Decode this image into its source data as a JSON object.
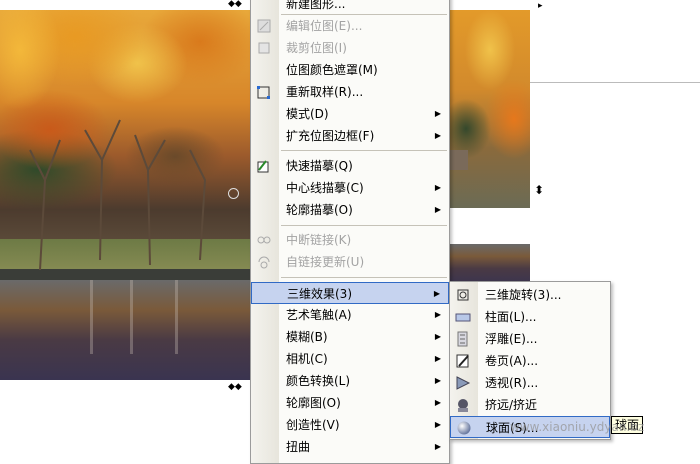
{
  "context_menu": {
    "items": [
      {
        "label": "新建图形...",
        "disabled": false,
        "submenu": false,
        "icon": "new-graphic-icon"
      },
      {
        "label": "编辑位图(E)...",
        "disabled": true,
        "submenu": false,
        "icon": "edit-bitmap-icon"
      },
      {
        "label": "裁剪位图(I)",
        "disabled": true,
        "submenu": false,
        "icon": "crop-bitmap-icon"
      },
      {
        "label": "位图颜色遮罩(M)",
        "disabled": false,
        "submenu": false,
        "icon": ""
      },
      {
        "label": "重新取样(R)...",
        "disabled": false,
        "submenu": false,
        "icon": "resample-icon"
      },
      {
        "label": "模式(D)",
        "disabled": false,
        "submenu": true,
        "icon": ""
      },
      {
        "label": "扩充位图边框(F)",
        "disabled": false,
        "submenu": true,
        "icon": ""
      },
      {
        "label": "快速描摹(Q)",
        "disabled": false,
        "submenu": false,
        "icon": "quick-trace-icon"
      },
      {
        "label": "中心线描摹(C)",
        "disabled": false,
        "submenu": true,
        "icon": ""
      },
      {
        "label": "轮廓描摹(O)",
        "disabled": false,
        "submenu": true,
        "icon": ""
      },
      {
        "label": "中断链接(K)",
        "disabled": true,
        "submenu": false,
        "icon": "break-link-icon"
      },
      {
        "label": "自链接更新(U)",
        "disabled": true,
        "submenu": false,
        "icon": "update-link-icon"
      },
      {
        "label": "三维效果(3)",
        "disabled": false,
        "submenu": true,
        "icon": "",
        "highlighted": true
      },
      {
        "label": "艺术笔触(A)",
        "disabled": false,
        "submenu": true,
        "icon": ""
      },
      {
        "label": "模糊(B)",
        "disabled": false,
        "submenu": true,
        "icon": ""
      },
      {
        "label": "相机(C)",
        "disabled": false,
        "submenu": true,
        "icon": ""
      },
      {
        "label": "颜色转换(L)",
        "disabled": false,
        "submenu": true,
        "icon": ""
      },
      {
        "label": "轮廓图(O)",
        "disabled": false,
        "submenu": true,
        "icon": ""
      },
      {
        "label": "创造性(V)",
        "disabled": false,
        "submenu": true,
        "icon": ""
      },
      {
        "label": "扭曲",
        "disabled": false,
        "submenu": true,
        "icon": ""
      }
    ]
  },
  "submenu_3d": {
    "items": [
      {
        "label": "三维旋转(3)...",
        "icon": "3d-rotate-icon"
      },
      {
        "label": "柱面(L)...",
        "icon": "cylinder-icon"
      },
      {
        "label": "浮雕(E)...",
        "icon": "emboss-icon"
      },
      {
        "label": "卷页(A)...",
        "icon": "page-curl-icon"
      },
      {
        "label": "透视(R)...",
        "icon": "perspective-icon"
      },
      {
        "label": "挤远/挤近",
        "icon": "pinch-punch-icon"
      },
      {
        "label": "球面(S)...",
        "icon": "sphere-icon",
        "highlighted": true
      }
    ]
  },
  "tooltip": "球面",
  "watermark": "www.xiaoniu.ydyan.bz",
  "colors": {
    "menu_bg": "#fbfbf8",
    "highlight_bg": "#c6d3ef",
    "highlight_border": "#316ac5",
    "disabled_text": "#a3a3a3"
  }
}
